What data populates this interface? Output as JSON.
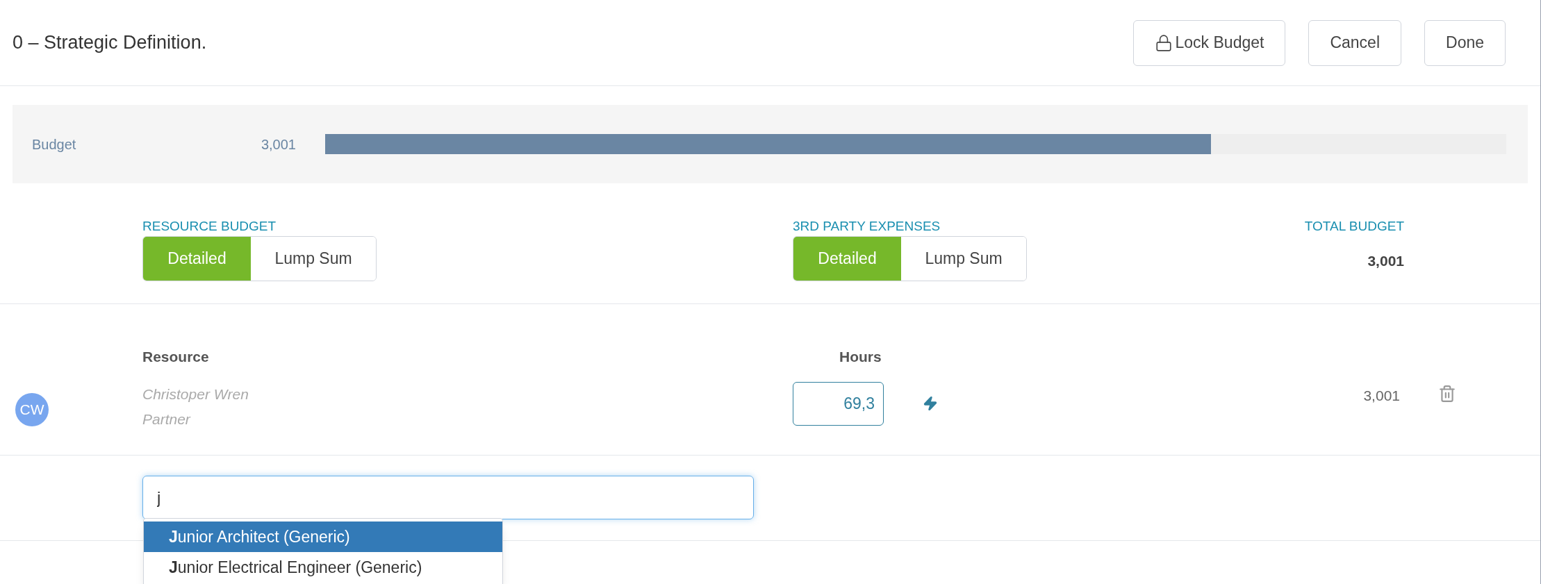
{
  "header": {
    "title": "0 – Strategic Definition.",
    "buttons": [
      {
        "label": "Lock Budget",
        "kind": "lock"
      },
      {
        "label": "Cancel",
        "kind": "plain"
      },
      {
        "label": "Done",
        "kind": "plain"
      }
    ]
  },
  "budget_bar": {
    "label": "Budget",
    "value": "3,001",
    "level": 0.75
  },
  "budget_modes": [
    {
      "title": "RESOURCE BUDGET",
      "options": [
        {
          "label": "Detailed",
          "selected": true
        },
        {
          "label": "Lump Sum",
          "selected": false
        }
      ]
    },
    {
      "title": "3RD PARTY EXPENSES",
      "options": [
        {
          "label": "Detailed",
          "selected": true
        },
        {
          "label": "Lump Sum",
          "selected": false
        }
      ]
    }
  ],
  "total_budget": {
    "title": "TOTAL BUDGET",
    "value": "3,001"
  },
  "table": {
    "columns": [
      "Resource",
      "Hours"
    ],
    "rows": [
      {
        "initials": "CW",
        "name": "Christoper Wren",
        "role": "Partner",
        "hours": "69,3",
        "total": "3,001"
      }
    ]
  },
  "search": {
    "value": "j",
    "suggestions": [
      {
        "label": "**J**unior Architect (Generic)",
        "selected": true
      },
      {
        "label": "**J**unior Electrical Engineer (Generic)",
        "selected": false
      }
    ]
  }
}
